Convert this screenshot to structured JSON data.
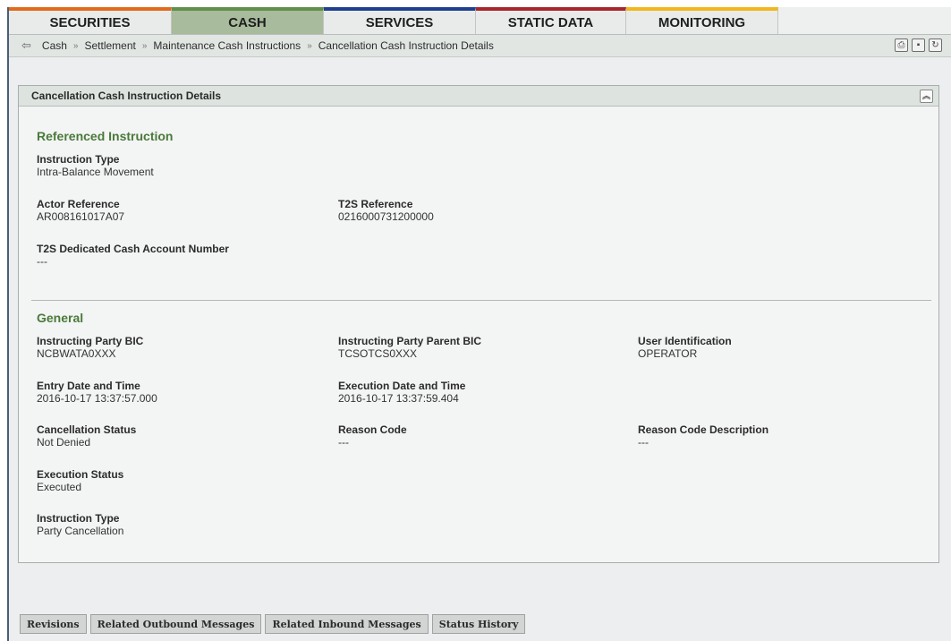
{
  "tabs": [
    {
      "label": "SECURITIES",
      "color": "#e26a1a"
    },
    {
      "label": "CASH",
      "color": "#5f8f4a"
    },
    {
      "label": "SERVICES",
      "color": "#1f3f8f"
    },
    {
      "label": "STATIC DATA",
      "color": "#a8262a"
    },
    {
      "label": "MONITORING",
      "color": "#f1b71b"
    }
  ],
  "breadcrumb": [
    "Cash",
    "Settlement",
    "Maintenance Cash Instructions",
    "Cancellation Cash Instruction Details"
  ],
  "breadcrumb_separator": "»",
  "panel_title": "Cancellation Cash Instruction Details",
  "referenced": {
    "title": "Referenced Instruction",
    "instruction_type": {
      "label": "Instruction Type",
      "value": "Intra-Balance Movement"
    },
    "actor_reference": {
      "label": "Actor Reference",
      "value": "AR008161017A07"
    },
    "t2s_reference": {
      "label": "T2S Reference",
      "value": "0216000731200000"
    },
    "dca_number": {
      "label": "T2S Dedicated Cash Account Number",
      "value": "---"
    }
  },
  "general": {
    "title": "General",
    "instructing_party_bic": {
      "label": "Instructing Party BIC",
      "value": "NCBWATA0XXX"
    },
    "instructing_party_parent_bic": {
      "label": "Instructing Party Parent BIC",
      "value": "TCSOTCS0XXX"
    },
    "user_identification": {
      "label": "User Identification",
      "value": "OPERATOR"
    },
    "entry_datetime": {
      "label": "Entry Date and Time",
      "value": "2016-10-17 13:37:57.000"
    },
    "execution_datetime": {
      "label": "Execution Date and Time",
      "value": "2016-10-17 13:37:59.404"
    },
    "cancellation_status": {
      "label": "Cancellation Status",
      "value": "Not Denied"
    },
    "reason_code": {
      "label": "Reason Code",
      "value": "---"
    },
    "reason_code_description": {
      "label": "Reason Code Description",
      "value": "---"
    },
    "execution_status": {
      "label": "Execution Status",
      "value": "Executed"
    },
    "instruction_type": {
      "label": "Instruction Type",
      "value": "Party Cancellation"
    }
  },
  "bottom_buttons": [
    "Revisions",
    "Related Outbound Messages",
    "Related Inbound Messages",
    "Status History"
  ]
}
